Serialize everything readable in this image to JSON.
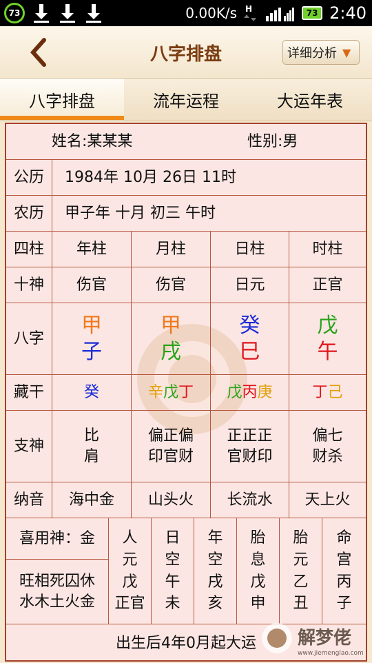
{
  "status_bar": {
    "notification_count": "73",
    "net_speed": "0.00K/s",
    "battery": "73",
    "time": "2:40",
    "accent_color": "#6fd12c"
  },
  "header": {
    "title": "八字排盘",
    "detail_button": "详细分析",
    "detail_caret": "▼"
  },
  "tabs": [
    {
      "label": "八字排盘",
      "active": true
    },
    {
      "label": "流年运程",
      "active": false
    },
    {
      "label": "大运年表",
      "active": false
    }
  ],
  "info": {
    "name": "姓名:某某某",
    "gender": "性别:男"
  },
  "solar": {
    "label": "公历",
    "value": "1984年 10月 26日 11时"
  },
  "lunar": {
    "label": "农历",
    "value": "甲子年 十月 初三 午时"
  },
  "pillars_header": {
    "label": "四柱",
    "cols": [
      "年柱",
      "月柱",
      "日柱",
      "时柱"
    ]
  },
  "ten_gods": {
    "label": "十神",
    "cols": [
      "伤官",
      "伤官",
      "日元",
      "正官"
    ]
  },
  "bazi": {
    "label": "八字",
    "stems": [
      "甲",
      "甲",
      "癸",
      "戊"
    ],
    "branches": [
      "子",
      "戌",
      "巳",
      "午"
    ]
  },
  "hidden_stems": {
    "label": "藏干",
    "cols": [
      [
        "癸"
      ],
      [
        "辛",
        "戊",
        "丁"
      ],
      [
        "戊",
        "丙",
        "庚"
      ],
      [
        "丁",
        "己"
      ]
    ]
  },
  "branch_gods": {
    "label": "支神",
    "cols": [
      [
        "比",
        "肩"
      ],
      [
        "偏正偏",
        "印官财"
      ],
      [
        "正正正",
        "官财印"
      ],
      [
        "偏七",
        "财杀"
      ]
    ]
  },
  "nayin": {
    "label": "纳音",
    "cols": [
      "海中金",
      "山头火",
      "长流水",
      "天上火"
    ]
  },
  "xiyong": {
    "label": "喜用神：金",
    "states": "旺相死囚休",
    "elements": "水木土火金"
  },
  "extra_cols": [
    {
      "lines": [
        "人",
        "元",
        "戊",
        "正官"
      ]
    },
    {
      "lines": [
        "日",
        "空",
        "午",
        "未"
      ]
    },
    {
      "lines": [
        "年",
        "空",
        "戌",
        "亥"
      ]
    },
    {
      "lines": [
        "胎",
        "息",
        "戊",
        "申"
      ]
    },
    {
      "lines": [
        "胎",
        "元",
        "乙",
        "丑"
      ]
    },
    {
      "lines": [
        "命",
        "宫",
        "丙",
        "子"
      ]
    }
  ],
  "footer": {
    "text": "出生后4年0月起大运",
    "logo_text": "解梦佬",
    "logo_url": "www.jiemenglao.com"
  }
}
